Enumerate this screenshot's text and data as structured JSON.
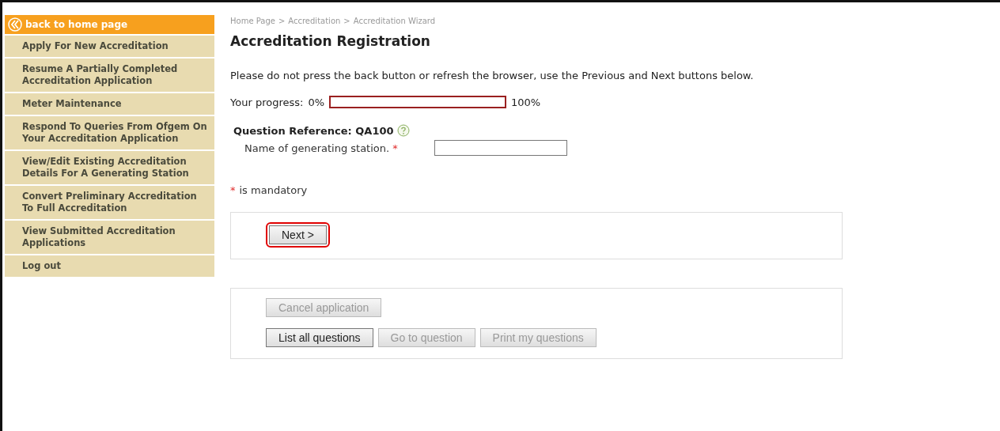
{
  "sidebar": {
    "back_link": "back to home page",
    "items": [
      {
        "label": "Apply For New Accreditation"
      },
      {
        "label": "Resume A Partially Completed Accreditation Application"
      },
      {
        "label": "Meter Maintenance"
      },
      {
        "label": "Respond To Queries From Ofgem On Your Accreditation Application"
      },
      {
        "label": "View/Edit Existing Accreditation Details For A Generating Station"
      },
      {
        "label": "Convert Preliminary Accreditation To Full Accreditation"
      },
      {
        "label": "View Submitted Accreditation Applications"
      },
      {
        "label": "Log out"
      }
    ]
  },
  "breadcrumb": [
    "Home Page",
    ">",
    "Accreditation",
    ">",
    "Accreditation Wizard"
  ],
  "title": "Accreditation Registration",
  "notice": "Please do not press the back button or refresh the browser, use the Previous and Next buttons below.",
  "progress": {
    "label": "Your progress:",
    "start": "0%",
    "end": "100%",
    "level": 0
  },
  "question": {
    "reference": "Question Reference: QA100",
    "field_label": "Name of generating station.",
    "required_mark": "*"
  },
  "legend": {
    "mark": "*",
    "text": "is mandatory"
  },
  "nav_panel": {
    "buttons": [
      {
        "label": "Next >",
        "disabled": false,
        "highlighted": true
      }
    ]
  },
  "actions_panel": {
    "rows": [
      [
        {
          "label": "Cancel application",
          "disabled": true
        }
      ],
      [
        {
          "label": "List all questions",
          "disabled": false
        },
        {
          "label": "Go to question",
          "disabled": true
        },
        {
          "label": "Print my questions",
          "disabled": true
        }
      ]
    ]
  }
}
